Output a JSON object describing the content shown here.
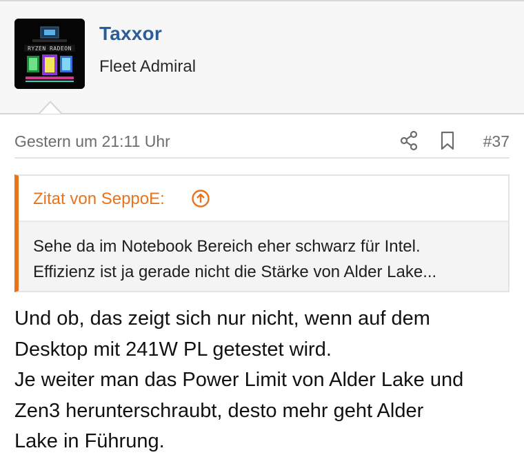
{
  "author": {
    "name": "Taxxor",
    "rank": "Fleet Admiral",
    "avatar_text": "RYZEN RADEON"
  },
  "post": {
    "date": "Gestern um 21:11 Uhr",
    "number": "#37",
    "actions": {
      "share_icon": "share-icon",
      "bookmark_icon": "bookmark-icon"
    },
    "quote": {
      "source": "Zitat von SeppoE:",
      "jump_icon": "arrow-up-circle-icon",
      "lines": [
        "Sehe da im Notebook Bereich eher schwarz für Intel.",
        "Effizienz ist ja gerade nicht die Stärke von Alder Lake..."
      ]
    },
    "body_lines": [
      "Und ob, das zeigt sich nur nicht, wenn auf dem",
      "Desktop mit 241W PL getestet wird.",
      "Je weiter man das Power Limit von Alder Lake und",
      "Zen3 herunterschraubt, desto mehr geht Alder",
      "Lake in Führung."
    ]
  },
  "colors": {
    "author_name": "#2b5d99",
    "quote_accent": "#e8731c",
    "meta_text": "#6d6d6d",
    "header_bg": "#f7f7f7"
  }
}
